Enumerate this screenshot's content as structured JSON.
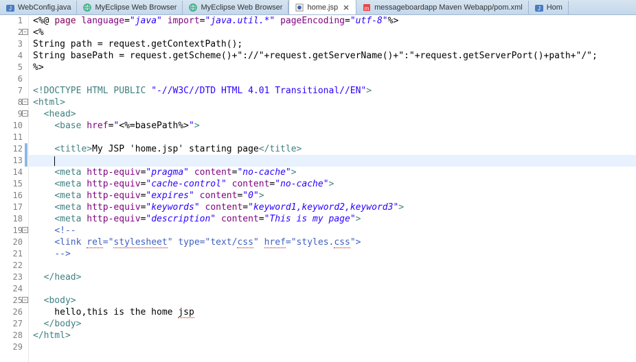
{
  "tabs": [
    {
      "label": "WebConfig.java",
      "icon": "java",
      "active": false
    },
    {
      "label": "MyEclipse Web Browser",
      "icon": "globe",
      "active": false
    },
    {
      "label": "MyEclipse Web Browser",
      "icon": "globe",
      "active": false
    },
    {
      "label": "home.jsp",
      "icon": "jsp",
      "active": true
    },
    {
      "label": "messageboardapp Maven Webapp/pom.xml",
      "icon": "maven",
      "active": false
    },
    {
      "label": "Hom",
      "icon": "java",
      "active": false
    }
  ],
  "cursor_line": 13,
  "change_marks": [
    12,
    13
  ],
  "fold_markers": {
    "2": "-",
    "8": "-",
    "9": "-",
    "19": "-",
    "25": "-"
  },
  "lines": [
    {
      "n": 1,
      "tokens": [
        {
          "t": "<%@",
          "c": "c-jsp"
        },
        {
          "t": " ",
          "c": "c-txt"
        },
        {
          "t": "page",
          "c": "c-kw"
        },
        {
          "t": " ",
          "c": "c-txt"
        },
        {
          "t": "language",
          "c": "c-attr"
        },
        {
          "t": "=",
          "c": "c-txt"
        },
        {
          "t": "\"java\"",
          "c": "c-str"
        },
        {
          "t": " ",
          "c": "c-txt"
        },
        {
          "t": "import",
          "c": "c-attr"
        },
        {
          "t": "=",
          "c": "c-txt"
        },
        {
          "t": "\"java.util.*\"",
          "c": "c-str"
        },
        {
          "t": " ",
          "c": "c-txt"
        },
        {
          "t": "pageEncoding",
          "c": "c-attr"
        },
        {
          "t": "=",
          "c": "c-txt"
        },
        {
          "t": "\"utf-8\"",
          "c": "c-str"
        },
        {
          "t": "%>",
          "c": "c-jsp"
        }
      ]
    },
    {
      "n": 2,
      "tokens": [
        {
          "t": "<%",
          "c": "c-jsp"
        }
      ]
    },
    {
      "n": 3,
      "tokens": [
        {
          "t": "String path = request.getContextPath();",
          "c": "c-txt"
        }
      ]
    },
    {
      "n": 4,
      "tokens": [
        {
          "t": "String basePath = request.getScheme()+\"://\"+request.getServerName()+\":\"+request.getServerPort()+path+\"/\";",
          "c": "c-txt"
        }
      ]
    },
    {
      "n": 5,
      "tokens": [
        {
          "t": "%>",
          "c": "c-jsp"
        }
      ]
    },
    {
      "n": 6,
      "tokens": []
    },
    {
      "n": 7,
      "tokens": [
        {
          "t": "<!",
          "c": "c-tag"
        },
        {
          "t": "DOCTYPE ",
          "c": "c-tag"
        },
        {
          "t": "HTML ",
          "c": "c-tag"
        },
        {
          "t": "PUBLIC ",
          "c": "c-tag"
        },
        {
          "t": "\"-//W3C//DTD HTML 4.01 Transitional//EN\"",
          "c": "c-strn"
        },
        {
          "t": ">",
          "c": "c-tag"
        }
      ]
    },
    {
      "n": 8,
      "tokens": [
        {
          "t": "<",
          "c": "c-tag"
        },
        {
          "t": "html",
          "c": "c-tag"
        },
        {
          "t": ">",
          "c": "c-tag"
        }
      ]
    },
    {
      "n": 9,
      "tokens": [
        {
          "t": "  ",
          "c": "c-txt"
        },
        {
          "t": "<",
          "c": "c-tag"
        },
        {
          "t": "head",
          "c": "c-tag"
        },
        {
          "t": ">",
          "c": "c-tag"
        }
      ]
    },
    {
      "n": 10,
      "tokens": [
        {
          "t": "    ",
          "c": "c-txt"
        },
        {
          "t": "<",
          "c": "c-tag"
        },
        {
          "t": "base",
          "c": "c-tag"
        },
        {
          "t": " ",
          "c": "c-txt"
        },
        {
          "t": "href",
          "c": "c-attr"
        },
        {
          "t": "=",
          "c": "c-txt"
        },
        {
          "t": "\"",
          "c": "c-str"
        },
        {
          "t": "<%=",
          "c": "c-jsp"
        },
        {
          "t": "basePath",
          "c": "c-txt"
        },
        {
          "t": "%>",
          "c": "c-jsp"
        },
        {
          "t": "\"",
          "c": "c-str"
        },
        {
          "t": ">",
          "c": "c-tag"
        }
      ]
    },
    {
      "n": 11,
      "tokens": [
        {
          "t": "    ",
          "c": "c-txt"
        }
      ]
    },
    {
      "n": 12,
      "tokens": [
        {
          "t": "    ",
          "c": "c-txt"
        },
        {
          "t": "<",
          "c": "c-tag"
        },
        {
          "t": "title",
          "c": "c-tag"
        },
        {
          "t": ">",
          "c": "c-tag"
        },
        {
          "t": "My JSP 'home.jsp' starting page",
          "c": "c-txt"
        },
        {
          "t": "</",
          "c": "c-tag"
        },
        {
          "t": "title",
          "c": "c-tag"
        },
        {
          "t": ">",
          "c": "c-tag"
        }
      ]
    },
    {
      "n": 13,
      "tokens": [
        {
          "t": "    ",
          "c": "c-txt"
        }
      ]
    },
    {
      "n": 14,
      "tokens": [
        {
          "t": "    ",
          "c": "c-txt"
        },
        {
          "t": "<",
          "c": "c-tag"
        },
        {
          "t": "meta",
          "c": "c-tag"
        },
        {
          "t": " ",
          "c": "c-txt"
        },
        {
          "t": "http-equiv",
          "c": "c-attr"
        },
        {
          "t": "=",
          "c": "c-txt"
        },
        {
          "t": "\"pragma\"",
          "c": "c-str"
        },
        {
          "t": " ",
          "c": "c-txt"
        },
        {
          "t": "content",
          "c": "c-attr"
        },
        {
          "t": "=",
          "c": "c-txt"
        },
        {
          "t": "\"no-cache\"",
          "c": "c-str"
        },
        {
          "t": ">",
          "c": "c-tag"
        }
      ]
    },
    {
      "n": 15,
      "tokens": [
        {
          "t": "    ",
          "c": "c-txt"
        },
        {
          "t": "<",
          "c": "c-tag"
        },
        {
          "t": "meta",
          "c": "c-tag"
        },
        {
          "t": " ",
          "c": "c-txt"
        },
        {
          "t": "http-equiv",
          "c": "c-attr"
        },
        {
          "t": "=",
          "c": "c-txt"
        },
        {
          "t": "\"cache-control\"",
          "c": "c-str"
        },
        {
          "t": " ",
          "c": "c-txt"
        },
        {
          "t": "content",
          "c": "c-attr"
        },
        {
          "t": "=",
          "c": "c-txt"
        },
        {
          "t": "\"no-cache\"",
          "c": "c-str"
        },
        {
          "t": ">",
          "c": "c-tag"
        }
      ]
    },
    {
      "n": 16,
      "tokens": [
        {
          "t": "    ",
          "c": "c-txt"
        },
        {
          "t": "<",
          "c": "c-tag"
        },
        {
          "t": "meta",
          "c": "c-tag"
        },
        {
          "t": " ",
          "c": "c-txt"
        },
        {
          "t": "http-equiv",
          "c": "c-attr"
        },
        {
          "t": "=",
          "c": "c-txt"
        },
        {
          "t": "\"expires\"",
          "c": "c-str"
        },
        {
          "t": " ",
          "c": "c-txt"
        },
        {
          "t": "content",
          "c": "c-attr"
        },
        {
          "t": "=",
          "c": "c-txt"
        },
        {
          "t": "\"0\"",
          "c": "c-str"
        },
        {
          "t": ">",
          "c": "c-tag"
        }
      ]
    },
    {
      "n": 17,
      "tokens": [
        {
          "t": "    ",
          "c": "c-txt"
        },
        {
          "t": "<",
          "c": "c-tag"
        },
        {
          "t": "meta",
          "c": "c-tag"
        },
        {
          "t": " ",
          "c": "c-txt"
        },
        {
          "t": "http-equiv",
          "c": "c-attr"
        },
        {
          "t": "=",
          "c": "c-txt"
        },
        {
          "t": "\"keywords\"",
          "c": "c-str"
        },
        {
          "t": " ",
          "c": "c-txt"
        },
        {
          "t": "content",
          "c": "c-attr"
        },
        {
          "t": "=",
          "c": "c-txt"
        },
        {
          "t": "\"keyword1,keyword2,keyword3\"",
          "c": "c-str"
        },
        {
          "t": ">",
          "c": "c-tag"
        }
      ]
    },
    {
      "n": 18,
      "tokens": [
        {
          "t": "    ",
          "c": "c-txt"
        },
        {
          "t": "<",
          "c": "c-tag"
        },
        {
          "t": "meta",
          "c": "c-tag"
        },
        {
          "t": " ",
          "c": "c-txt"
        },
        {
          "t": "http-equiv",
          "c": "c-attr"
        },
        {
          "t": "=",
          "c": "c-txt"
        },
        {
          "t": "\"description\"",
          "c": "c-str"
        },
        {
          "t": " ",
          "c": "c-txt"
        },
        {
          "t": "content",
          "c": "c-attr"
        },
        {
          "t": "=",
          "c": "c-txt"
        },
        {
          "t": "\"This is my page\"",
          "c": "c-str"
        },
        {
          "t": ">",
          "c": "c-tag"
        }
      ]
    },
    {
      "n": 19,
      "tokens": [
        {
          "t": "    ",
          "c": "c-txt"
        },
        {
          "t": "<!--",
          "c": "c-cmt"
        }
      ]
    },
    {
      "n": 20,
      "tokens": [
        {
          "t": "    ",
          "c": "c-txt"
        },
        {
          "t": "<link ",
          "c": "c-cmt"
        },
        {
          "t": "rel",
          "c": "c-cmt c-err"
        },
        {
          "t": "=\"",
          "c": "c-cmt"
        },
        {
          "t": "stylesheet",
          "c": "c-cmt c-err"
        },
        {
          "t": "\" type=\"text/",
          "c": "c-cmt"
        },
        {
          "t": "css",
          "c": "c-cmt c-err"
        },
        {
          "t": "\" ",
          "c": "c-cmt"
        },
        {
          "t": "href",
          "c": "c-cmt c-err"
        },
        {
          "t": "=\"styles.",
          "c": "c-cmt"
        },
        {
          "t": "css",
          "c": "c-cmt c-err"
        },
        {
          "t": "\">",
          "c": "c-cmt"
        }
      ]
    },
    {
      "n": 21,
      "tokens": [
        {
          "t": "    ",
          "c": "c-txt"
        },
        {
          "t": "-->",
          "c": "c-cmt"
        }
      ]
    },
    {
      "n": 22,
      "tokens": []
    },
    {
      "n": 23,
      "tokens": [
        {
          "t": "  ",
          "c": "c-txt"
        },
        {
          "t": "</",
          "c": "c-tag"
        },
        {
          "t": "head",
          "c": "c-tag"
        },
        {
          "t": ">",
          "c": "c-tag"
        }
      ]
    },
    {
      "n": 24,
      "tokens": [
        {
          "t": "  ",
          "c": "c-txt"
        }
      ]
    },
    {
      "n": 25,
      "tokens": [
        {
          "t": "  ",
          "c": "c-txt"
        },
        {
          "t": "<",
          "c": "c-tag"
        },
        {
          "t": "body",
          "c": "c-tag"
        },
        {
          "t": ">",
          "c": "c-tag"
        }
      ]
    },
    {
      "n": 26,
      "tokens": [
        {
          "t": "    hello,this is the home ",
          "c": "c-txt"
        },
        {
          "t": "jsp",
          "c": "c-txt c-err"
        }
      ]
    },
    {
      "n": 27,
      "tokens": [
        {
          "t": "  ",
          "c": "c-txt"
        },
        {
          "t": "</",
          "c": "c-tag"
        },
        {
          "t": "body",
          "c": "c-tag"
        },
        {
          "t": ">",
          "c": "c-tag"
        }
      ]
    },
    {
      "n": 28,
      "tokens": [
        {
          "t": "</",
          "c": "c-tag"
        },
        {
          "t": "html",
          "c": "c-tag"
        },
        {
          "t": ">",
          "c": "c-tag"
        }
      ]
    },
    {
      "n": 29,
      "tokens": []
    }
  ]
}
